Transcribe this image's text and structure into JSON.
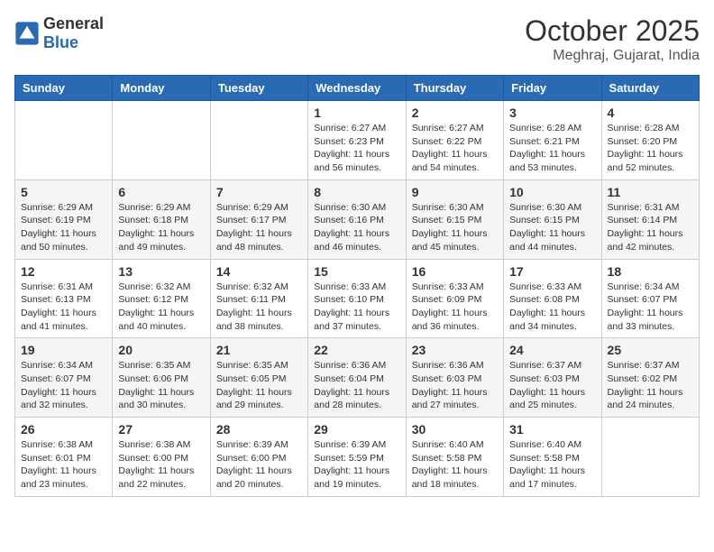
{
  "app": {
    "logo_general": "General",
    "logo_blue": "Blue"
  },
  "header": {
    "month": "October 2025",
    "location": "Meghraj, Gujarat, India"
  },
  "weekdays": [
    "Sunday",
    "Monday",
    "Tuesday",
    "Wednesday",
    "Thursday",
    "Friday",
    "Saturday"
  ],
  "weeks": [
    [
      {
        "day": "",
        "info": ""
      },
      {
        "day": "",
        "info": ""
      },
      {
        "day": "",
        "info": ""
      },
      {
        "day": "1",
        "info": "Sunrise: 6:27 AM\nSunset: 6:23 PM\nDaylight: 11 hours\nand 56 minutes."
      },
      {
        "day": "2",
        "info": "Sunrise: 6:27 AM\nSunset: 6:22 PM\nDaylight: 11 hours\nand 54 minutes."
      },
      {
        "day": "3",
        "info": "Sunrise: 6:28 AM\nSunset: 6:21 PM\nDaylight: 11 hours\nand 53 minutes."
      },
      {
        "day": "4",
        "info": "Sunrise: 6:28 AM\nSunset: 6:20 PM\nDaylight: 11 hours\nand 52 minutes."
      }
    ],
    [
      {
        "day": "5",
        "info": "Sunrise: 6:29 AM\nSunset: 6:19 PM\nDaylight: 11 hours\nand 50 minutes."
      },
      {
        "day": "6",
        "info": "Sunrise: 6:29 AM\nSunset: 6:18 PM\nDaylight: 11 hours\nand 49 minutes."
      },
      {
        "day": "7",
        "info": "Sunrise: 6:29 AM\nSunset: 6:17 PM\nDaylight: 11 hours\nand 48 minutes."
      },
      {
        "day": "8",
        "info": "Sunrise: 6:30 AM\nSunset: 6:16 PM\nDaylight: 11 hours\nand 46 minutes."
      },
      {
        "day": "9",
        "info": "Sunrise: 6:30 AM\nSunset: 6:15 PM\nDaylight: 11 hours\nand 45 minutes."
      },
      {
        "day": "10",
        "info": "Sunrise: 6:30 AM\nSunset: 6:15 PM\nDaylight: 11 hours\nand 44 minutes."
      },
      {
        "day": "11",
        "info": "Sunrise: 6:31 AM\nSunset: 6:14 PM\nDaylight: 11 hours\nand 42 minutes."
      }
    ],
    [
      {
        "day": "12",
        "info": "Sunrise: 6:31 AM\nSunset: 6:13 PM\nDaylight: 11 hours\nand 41 minutes."
      },
      {
        "day": "13",
        "info": "Sunrise: 6:32 AM\nSunset: 6:12 PM\nDaylight: 11 hours\nand 40 minutes."
      },
      {
        "day": "14",
        "info": "Sunrise: 6:32 AM\nSunset: 6:11 PM\nDaylight: 11 hours\nand 38 minutes."
      },
      {
        "day": "15",
        "info": "Sunrise: 6:33 AM\nSunset: 6:10 PM\nDaylight: 11 hours\nand 37 minutes."
      },
      {
        "day": "16",
        "info": "Sunrise: 6:33 AM\nSunset: 6:09 PM\nDaylight: 11 hours\nand 36 minutes."
      },
      {
        "day": "17",
        "info": "Sunrise: 6:33 AM\nSunset: 6:08 PM\nDaylight: 11 hours\nand 34 minutes."
      },
      {
        "day": "18",
        "info": "Sunrise: 6:34 AM\nSunset: 6:07 PM\nDaylight: 11 hours\nand 33 minutes."
      }
    ],
    [
      {
        "day": "19",
        "info": "Sunrise: 6:34 AM\nSunset: 6:07 PM\nDaylight: 11 hours\nand 32 minutes."
      },
      {
        "day": "20",
        "info": "Sunrise: 6:35 AM\nSunset: 6:06 PM\nDaylight: 11 hours\nand 30 minutes."
      },
      {
        "day": "21",
        "info": "Sunrise: 6:35 AM\nSunset: 6:05 PM\nDaylight: 11 hours\nand 29 minutes."
      },
      {
        "day": "22",
        "info": "Sunrise: 6:36 AM\nSunset: 6:04 PM\nDaylight: 11 hours\nand 28 minutes."
      },
      {
        "day": "23",
        "info": "Sunrise: 6:36 AM\nSunset: 6:03 PM\nDaylight: 11 hours\nand 27 minutes."
      },
      {
        "day": "24",
        "info": "Sunrise: 6:37 AM\nSunset: 6:03 PM\nDaylight: 11 hours\nand 25 minutes."
      },
      {
        "day": "25",
        "info": "Sunrise: 6:37 AM\nSunset: 6:02 PM\nDaylight: 11 hours\nand 24 minutes."
      }
    ],
    [
      {
        "day": "26",
        "info": "Sunrise: 6:38 AM\nSunset: 6:01 PM\nDaylight: 11 hours\nand 23 minutes."
      },
      {
        "day": "27",
        "info": "Sunrise: 6:38 AM\nSunset: 6:00 PM\nDaylight: 11 hours\nand 22 minutes."
      },
      {
        "day": "28",
        "info": "Sunrise: 6:39 AM\nSunset: 6:00 PM\nDaylight: 11 hours\nand 20 minutes."
      },
      {
        "day": "29",
        "info": "Sunrise: 6:39 AM\nSunset: 5:59 PM\nDaylight: 11 hours\nand 19 minutes."
      },
      {
        "day": "30",
        "info": "Sunrise: 6:40 AM\nSunset: 5:58 PM\nDaylight: 11 hours\nand 18 minutes."
      },
      {
        "day": "31",
        "info": "Sunrise: 6:40 AM\nSunset: 5:58 PM\nDaylight: 11 hours\nand 17 minutes."
      },
      {
        "day": "",
        "info": ""
      }
    ]
  ]
}
